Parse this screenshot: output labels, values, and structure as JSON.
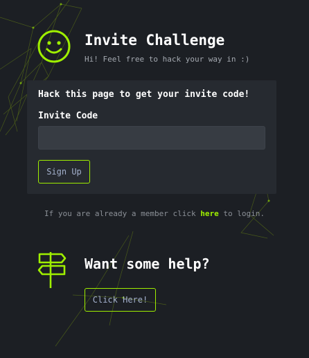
{
  "header": {
    "title": "Invite Challenge",
    "subtitle": "Hi! Feel free to hack your way in :)",
    "icon": "smiley-face-icon"
  },
  "card": {
    "heading": "Hack this page to get your invite code!",
    "field_label": "Invite Code",
    "input_value": "",
    "input_placeholder": "",
    "signup_label": "Sign Up"
  },
  "login": {
    "prefix": "If you are already a member click ",
    "link_text": "here",
    "suffix": " to login."
  },
  "help": {
    "icon": "signpost-icon",
    "title": "Want some help?",
    "button_label": "Click Here!"
  },
  "colors": {
    "background": "#1c1f24",
    "card": "#262a30",
    "input": "#373c43",
    "accent": "#9fef00",
    "text": "#ffffff",
    "muted": "#a4a9b0"
  }
}
